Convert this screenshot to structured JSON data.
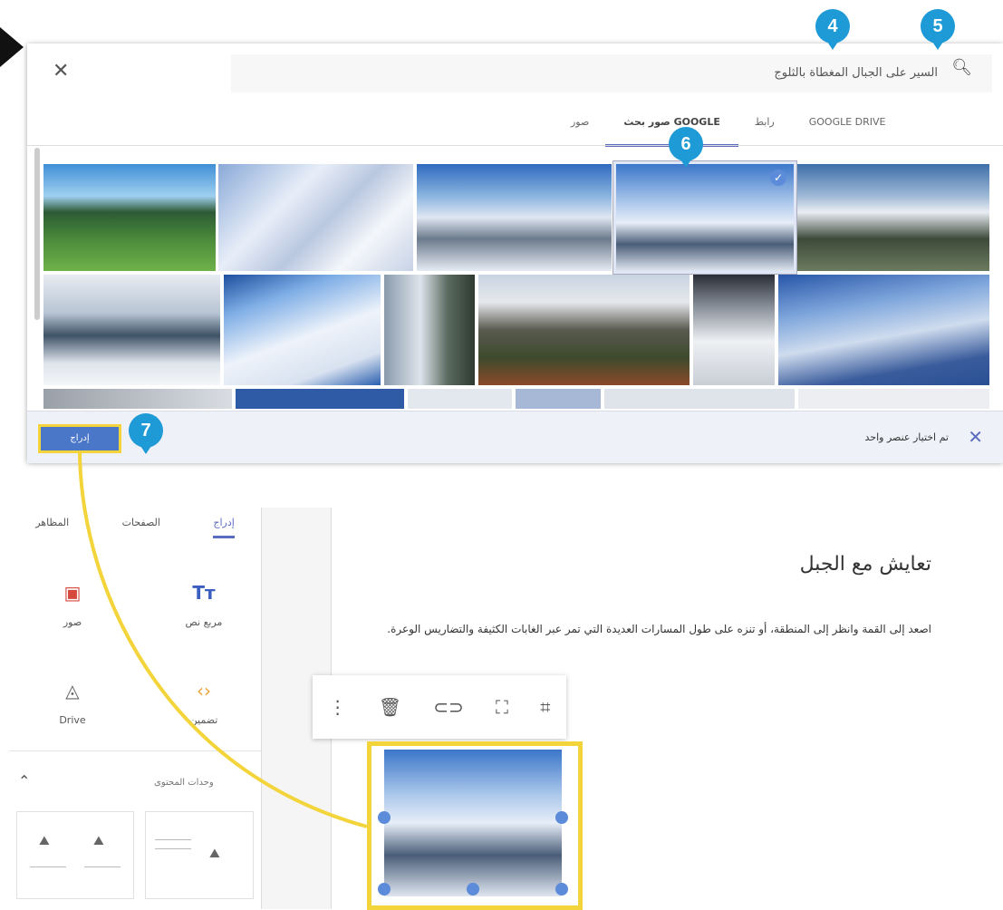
{
  "dialog": {
    "search_text": "السير على الجبال المغطاة بالثلوج",
    "tabs": [
      "GOOGLE DRIVE",
      "رابط",
      "صور بحث GOOGLE",
      "صور"
    ],
    "active_tab": "صور بحث GOOGLE",
    "selected_text": "تم اختيار عنصر واحد",
    "insert_label": "إدراج"
  },
  "badges": [
    "4",
    "5",
    "6",
    "7"
  ],
  "editor": {
    "side_tabs": [
      "إدراج",
      "الصفحات",
      "المظاهر"
    ],
    "tools": {
      "text_box": "مربع نص",
      "images": "صور",
      "embed": "تضمين",
      "drive": "Drive"
    },
    "layouts_label": "وحدات المحتوى",
    "page_title": "تعايش مع الجبل",
    "page_body": "اصعد إلى القمة وانظر إلى المنطقة، أو تنزه على طول المسارات العديدة التي تمر عبر الغابات الكثيفة والتضاريس الوعرة."
  },
  "colors": {
    "accent": "#5b6bc0",
    "badge": "#1e9ad6",
    "highlight": "#f3d43b",
    "insert_button": "#4a77c7"
  },
  "icons": [
    "search-icon",
    "close-icon",
    "check-icon",
    "more-vert-icon",
    "trash-icon",
    "link-icon",
    "fullscreen-icon",
    "crop-icon",
    "image-icon",
    "text-icon",
    "embed-icon",
    "drive-icon"
  ]
}
